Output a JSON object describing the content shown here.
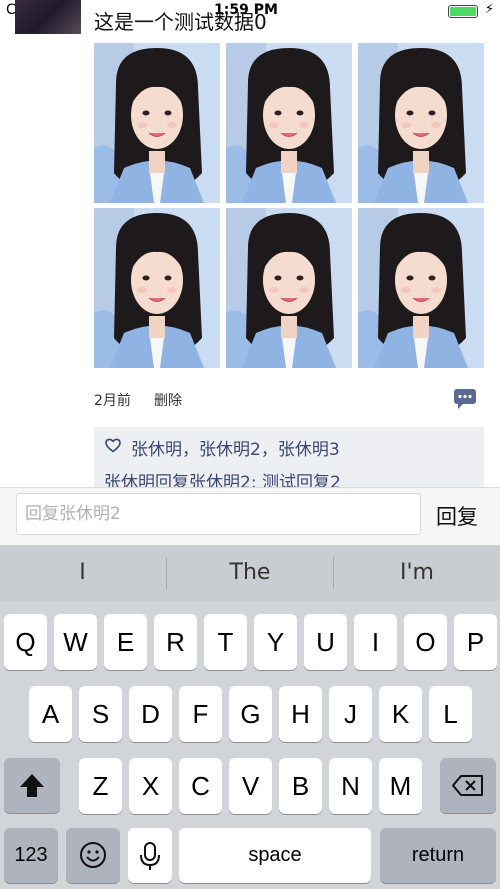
{
  "status_bar": {
    "carrier": "Carrier",
    "time": "1:59 PM",
    "battery_level": 1.0
  },
  "post": {
    "text": "这是一个测试数据0",
    "photo_count": 6,
    "time_ago": "2月前",
    "delete_label": "删除",
    "likes": "张休明，张休明2，张休明3",
    "reply": "张休明回复张休明2: 测试回复2"
  },
  "reply_bar": {
    "placeholder": "回复张休明2",
    "value": "",
    "send_label": "回复"
  },
  "keyboard": {
    "suggestions": [
      "I",
      "The",
      "I'm"
    ],
    "row1": [
      "Q",
      "W",
      "E",
      "R",
      "T",
      "Y",
      "U",
      "I",
      "O",
      "P"
    ],
    "row2": [
      "A",
      "S",
      "D",
      "F",
      "G",
      "H",
      "J",
      "K",
      "L"
    ],
    "row3": [
      "Z",
      "X",
      "C",
      "V",
      "B",
      "N",
      "M"
    ],
    "numbers_label": "123",
    "space_label": "space",
    "return_label": "return"
  },
  "colors": {
    "link": "#3b4673",
    "keyboard_bg": "#d1d4d9",
    "battery": "#4cd964"
  }
}
